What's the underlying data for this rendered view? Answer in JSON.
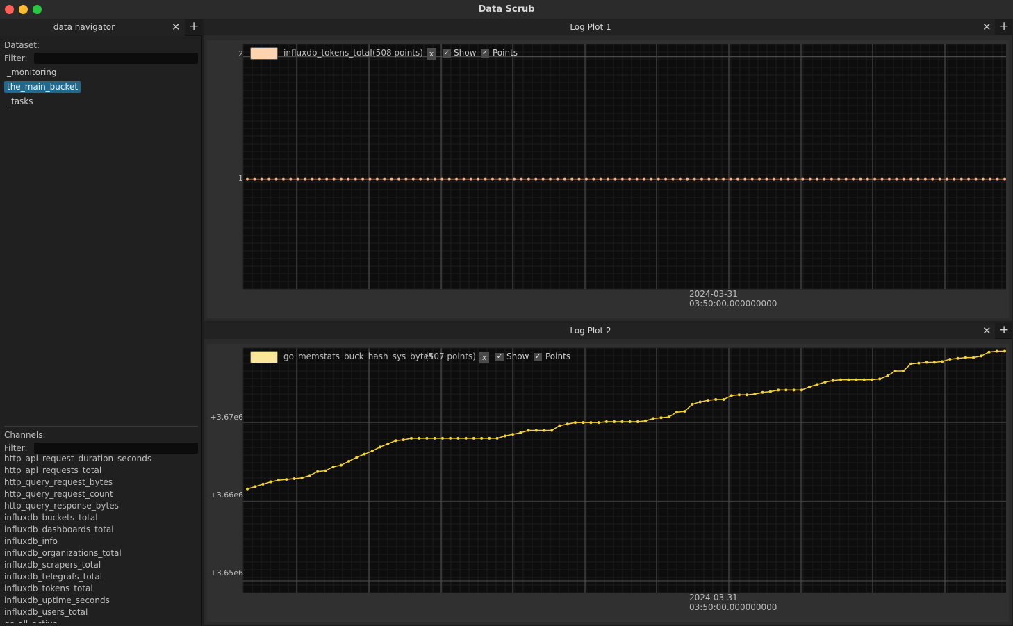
{
  "window": {
    "title": "Data Scrub"
  },
  "navigator": {
    "tab_title": "data navigator",
    "dataset_label": "Dataset:",
    "filter_label": "Filter:",
    "datasets": [
      {
        "name": "_monitoring",
        "selected": false
      },
      {
        "name": "the_main_bucket",
        "selected": true
      },
      {
        "name": "_tasks",
        "selected": false
      }
    ],
    "channels_label": "Channels:",
    "channels_filter_label": "Filter:",
    "channels": [
      "http_api_request_duration_seconds",
      "http_api_requests_total",
      "http_query_request_bytes",
      "http_query_request_count",
      "http_query_response_bytes",
      "influxdb_buckets_total",
      "influxdb_dashboards_total",
      "influxdb_info",
      "influxdb_organizations_total",
      "influxdb_scrapers_total",
      "influxdb_telegrafs_total",
      "influxdb_tokens_total",
      "influxdb_uptime_seconds",
      "influxdb_users_total",
      "qc_all_active"
    ]
  },
  "plots": [
    {
      "title": "Log Plot 1",
      "legend": {
        "series_name": "influxdb_tokens_total",
        "points_label": "(508 points)",
        "remove_label": "x",
        "show_label": "Show",
        "points_toggle_label": "Points",
        "show_checked": true,
        "points_checked": true
      },
      "x_date_line1": "2024-03-31",
      "x_date_line2": "03:50:00.000000000",
      "y_ticks": [
        "2",
        "1"
      ],
      "colors": {
        "series": "#f3b48c",
        "swatch": "#fdd3b0"
      }
    },
    {
      "title": "Log Plot 2",
      "legend": {
        "series_name": "go_memstats_buck_hash_sys_bytes",
        "points_label": "(507 points)",
        "remove_label": "x",
        "show_label": "Show",
        "points_toggle_label": "Points",
        "show_checked": true,
        "points_checked": true
      },
      "x_date_line1": "2024-03-31",
      "x_date_line2": "03:50:00.000000000",
      "y_ticks": [
        "+3.67e6",
        "+3.66e6",
        "+3.65e6"
      ],
      "colors": {
        "series": "#f3d23a",
        "swatch": "#fbe79a"
      }
    }
  ],
  "chart_data": [
    {
      "type": "line",
      "series": [
        {
          "name": "influxdb_tokens_total",
          "point_count": 508,
          "y_constant": 1
        }
      ],
      "y_ticks": [
        2,
        1
      ],
      "ylim": [
        0.1,
        2.1
      ],
      "grid": true,
      "legend_position": "top-left"
    },
    {
      "type": "line",
      "series": [
        {
          "name": "go_memstats_buck_hash_sys_bytes",
          "point_count": 507,
          "values": [
            3661600,
            3661900,
            3662200,
            3662500,
            3662700,
            3662800,
            3662900,
            3663000,
            3663300,
            3663800,
            3663900,
            3664400,
            3664600,
            3665100,
            3665600,
            3666000,
            3666400,
            3666900,
            3667300,
            3667700,
            3667800,
            3668000,
            3668000,
            3668000,
            3668000,
            3668000,
            3668000,
            3668000,
            3668000,
            3668000,
            3668000,
            3668000,
            3668000,
            3668300,
            3668500,
            3668700,
            3669000,
            3669000,
            3669000,
            3669000,
            3669600,
            3669800,
            3670000,
            3670000,
            3670000,
            3670000,
            3670100,
            3670100,
            3670100,
            3670100,
            3670100,
            3670200,
            3670500,
            3670600,
            3670700,
            3671300,
            3671400,
            3672300,
            3672600,
            3672800,
            3672900,
            3672900,
            3673400,
            3673500,
            3673500,
            3673600,
            3673800,
            3673900,
            3674100,
            3674100,
            3674100,
            3674100,
            3674500,
            3674800,
            3675100,
            3675300,
            3675400,
            3675400,
            3675400,
            3675400,
            3675400,
            3675500,
            3675900,
            3676500,
            3676500,
            3677400,
            3677500,
            3677600,
            3677600,
            3677700,
            3678000,
            3678100,
            3678200,
            3678200,
            3678400,
            3678900,
            3679000,
            3679000
          ]
        }
      ],
      "y_ticks": [
        3670000,
        3660000,
        3650000
      ],
      "ylim": [
        3648500,
        3679400
      ],
      "grid": true,
      "legend_position": "top-left"
    }
  ]
}
